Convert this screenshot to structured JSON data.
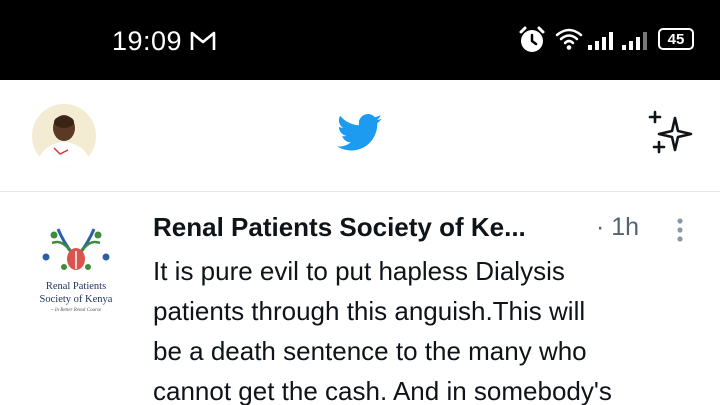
{
  "status_bar": {
    "time": "19:09",
    "battery": "45"
  },
  "icons": {
    "gmail": "gmail-icon",
    "alarm": "alarm-icon",
    "wifi": "wifi-icon",
    "signal": "signal-icon",
    "avatar": "profile-avatar",
    "logo": "twitter-bird-icon",
    "sparkle": "sparkle-icon",
    "more": "more-vertical-icon"
  },
  "colors": {
    "twitter_blue": "#1d9bf0",
    "text": "#0f1419",
    "muted": "#536471"
  },
  "tweet": {
    "author": "Renal Patients Society of Ke...",
    "time": "· 1h",
    "avatar_text": {
      "line1": "Renal Patients",
      "line2": "Society of Kenya",
      "line3": "~ In Better Renal Course"
    },
    "lines": [
      "It is pure evil to put hapless Dialysis",
      "patients through this anguish.This will",
      "be a death sentence to the many who",
      "cannot get the cash. And in somebody's"
    ]
  }
}
